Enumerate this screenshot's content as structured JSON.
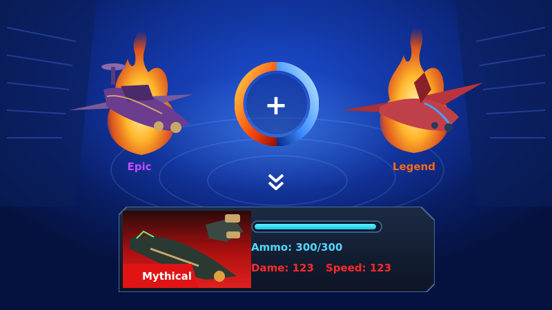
{
  "fusion": {
    "left_ship": {
      "rarity": "Epic",
      "rarity_color": "#c24dff"
    },
    "right_ship": {
      "rarity": "Legend",
      "rarity_color": "#ff6a1a"
    },
    "combine_symbol": "+",
    "result_arrow": "double-chevron-down-icon"
  },
  "result_card": {
    "rarity": "Mythical",
    "rarity_color": "#e01414",
    "ammo_fill": 0.98,
    "ammo_label": "Ammo: 300/300",
    "damage_label": "Dame: 123",
    "speed_label": "Speed: 123",
    "ammo_color": "#52d7ff",
    "stat_color": "#ff2a2a"
  }
}
